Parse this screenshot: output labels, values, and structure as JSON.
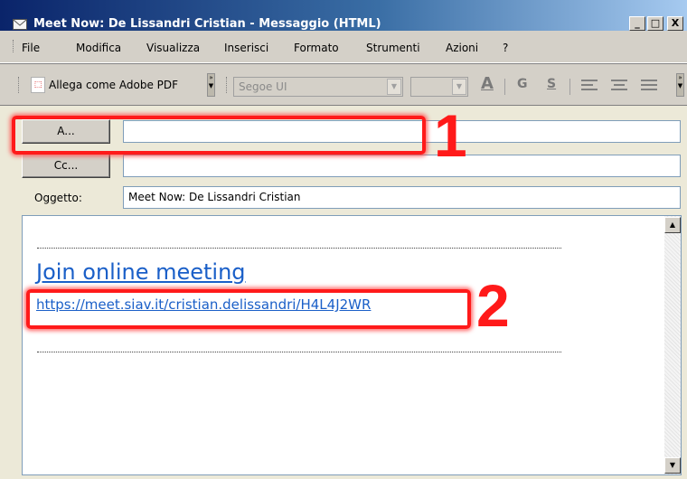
{
  "window": {
    "title": "Meet Now: De Lissandri Cristian - Messaggio (HTML)",
    "controls": [
      "_",
      "□",
      "X"
    ]
  },
  "menu": [
    "File",
    "Modifica",
    "Visualizza",
    "Inserisci",
    "Formato",
    "Strumenti",
    "Azioni",
    "?"
  ],
  "toolbar": {
    "attach_pdf_label": "Allega come Adobe PDF",
    "font_name": "Segoe UI",
    "font_size": "",
    "format_buttons": [
      "A",
      "G",
      "S"
    ]
  },
  "header": {
    "to_button": "A...",
    "to_value": "",
    "cc_button": "Cc...",
    "cc_value": "",
    "subject_label": "Oggetto:",
    "subject_value": "Meet Now: De Lissandri Cristian"
  },
  "body": {
    "join_text": "Join online meeting",
    "link": "https://meet.siav.it/cristian.delissandri/H4L4J2WR"
  },
  "annotations": [
    "1",
    "2"
  ],
  "colors": {
    "highlight": "#ff1a1a",
    "link": "#1a5fc8",
    "titlebar": "#0a246a"
  }
}
